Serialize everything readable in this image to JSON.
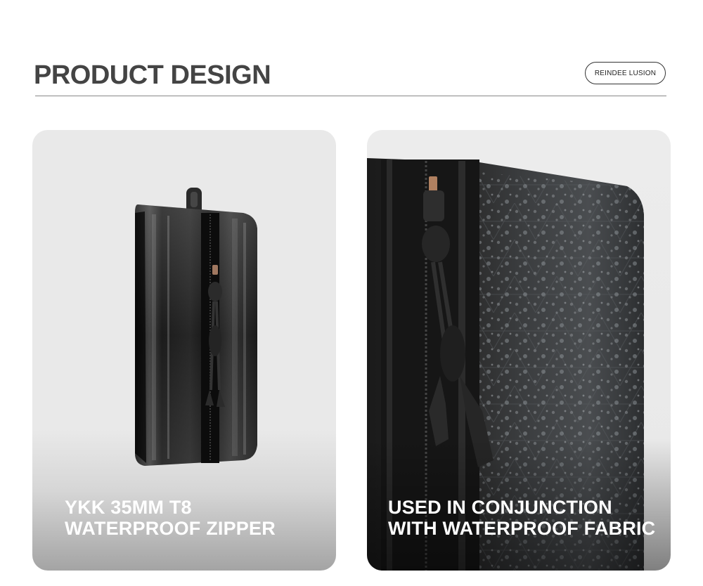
{
  "header": {
    "title": "PRODUCT DESIGN",
    "brand": "REINDEE LUSION"
  },
  "cards": [
    {
      "caption_line1": "YKK 35MM T8",
      "caption_line2": "WATERPROOF ZIPPER",
      "photo": "waterproof-zipper-pouch-photo"
    },
    {
      "caption_line1": "USED IN CONJUNCTION",
      "caption_line2": "WITH WATERPROOF FABRIC",
      "photo": "wet-fabric-closeup-photo"
    }
  ],
  "colors": {
    "title": "#444444",
    "card_bg": "#e9e9e9",
    "caption": "#ffffff"
  }
}
